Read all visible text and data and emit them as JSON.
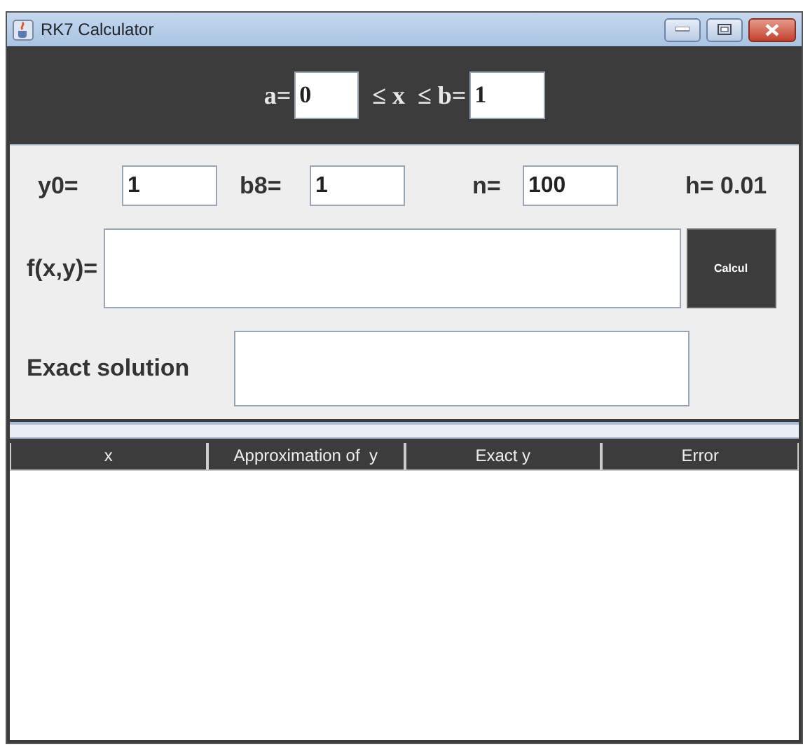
{
  "window": {
    "title": "RK7 Calculator"
  },
  "range": {
    "a_label": "a=",
    "a_value": "0",
    "mid_label": "≤ x  ≤ b=",
    "b_value": "1"
  },
  "params": [
    {
      "label": "y0=",
      "value": "1"
    },
    {
      "label": "b8=",
      "value": "1"
    },
    {
      "label": "n=",
      "value": "100"
    }
  ],
  "h_label": "h= 0.01",
  "function": {
    "label": "f(x,y)=",
    "button": "Calcul"
  },
  "exact": {
    "label": "Exact solution"
  },
  "table": {
    "columns": [
      "x",
      "Approximation of  y",
      "Exact y",
      "Error"
    ]
  }
}
